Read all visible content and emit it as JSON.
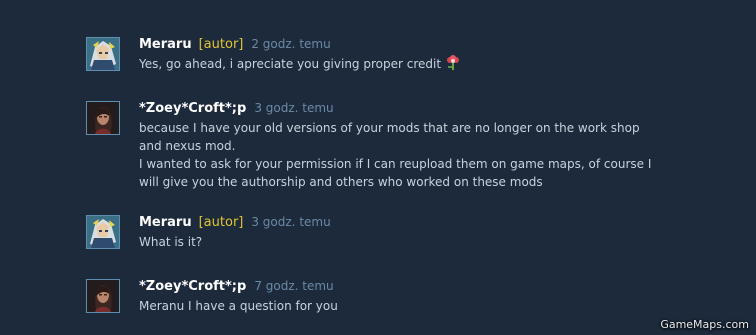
{
  "comments": [
    {
      "author": "Meraru",
      "badge": "[autor]",
      "time": "2 godz. temu",
      "text": "Yes, go ahead, i apreciate you giving proper credit",
      "avatar": "meraru-avatar",
      "emoticon": "flower-emoticon"
    },
    {
      "author": "*Zoey*Croft*;p",
      "badge": "",
      "time": "3 godz. temu",
      "text": "because I have your old versions of your mods that are no longer on the work shop\nand nexus mod.\nI wanted to ask for your permission if I can reupload them on game maps, of course I\nwill give you the authorship and others who worked on these mods",
      "avatar": "zoey-avatar"
    },
    {
      "author": "Meraru",
      "badge": "[autor]",
      "time": "3 godz. temu",
      "text": "What is it?",
      "avatar": "meraru-avatar"
    },
    {
      "author": "*Zoey*Croft*;p",
      "badge": "",
      "time": "7 godz. temu",
      "text": "Meranu I have a question for you",
      "avatar": "zoey-avatar"
    }
  ],
  "watermark": "GameMaps.com",
  "colors": {
    "background": "#1c2a3b",
    "author": "#ffffff",
    "badge": "#e2c531",
    "timestamp": "#6b8aa5",
    "text": "#c6d4df"
  }
}
